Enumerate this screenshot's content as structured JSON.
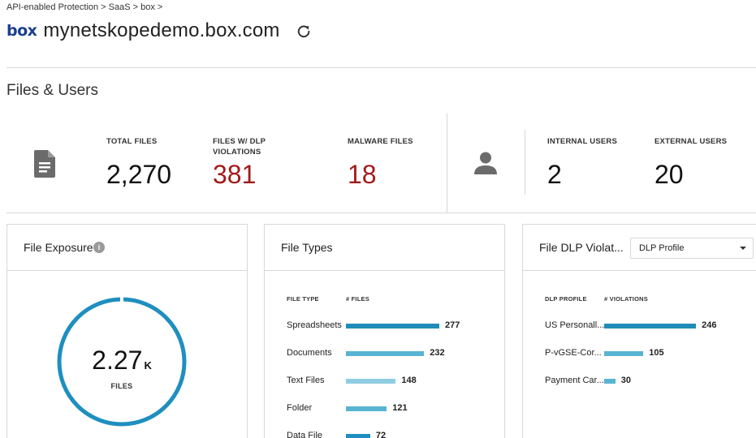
{
  "breadcrumb": "API-enabled Protection > SaaS > box >",
  "header": {
    "logo": "box",
    "title": "mynetskopedemo.box.com"
  },
  "section_title": "Files & Users",
  "stats": {
    "total_files": {
      "label": "TOTAL FILES",
      "value": "2,270"
    },
    "dlp_files": {
      "label": "FILES W/ DLP VIOLATIONS",
      "value": "381"
    },
    "malware_files": {
      "label": "MALWARE FILES",
      "value": "18"
    },
    "internal_users": {
      "label": "INTERNAL USERS",
      "value": "2"
    },
    "external_users": {
      "label": "EXTERNAL USERS",
      "value": "20"
    }
  },
  "exposure": {
    "title": "File Exposure",
    "info": "i",
    "total_display": "2.27",
    "suffix": "K",
    "unit": "FILES"
  },
  "file_types": {
    "title": "File Types",
    "col_type": "FILE TYPE",
    "col_count": "# FILES",
    "rows": [
      {
        "label": "Spreadsheets",
        "value": 277
      },
      {
        "label": "Documents",
        "value": 232
      },
      {
        "label": "Text Files",
        "value": 148
      },
      {
        "label": "Folder",
        "value": 121
      },
      {
        "label": "Data File",
        "value": 72
      }
    ]
  },
  "dlp": {
    "title": "File DLP Violat...",
    "dropdown_value": "DLP Profile",
    "col_profile": "DLP PROFILE",
    "col_violations": "# VIOLATIONS",
    "rows": [
      {
        "label": "US Personall...",
        "value": 246
      },
      {
        "label": "P-vGSE-Cor...",
        "value": 105
      },
      {
        "label": "Payment Car...",
        "value": 30
      }
    ]
  },
  "colors": {
    "accent": "#1e8fbf",
    "bar_dark": "#1f8db8",
    "bar_mid": "#58b4d2",
    "bar_light": "#8fcde3",
    "danger": "#a11b1b"
  }
}
